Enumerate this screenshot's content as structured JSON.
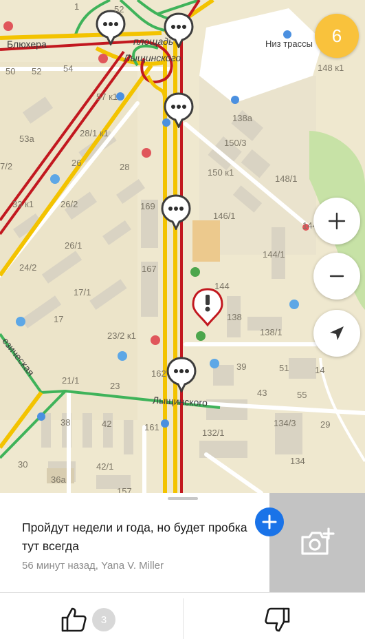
{
  "map": {
    "street_labels": [
      {
        "name": "street-bluhera",
        "text": "Блюхера"
      },
      {
        "name": "street-ploshchad",
        "text": "площадь"
      },
      {
        "name": "street-lyshchinskogo-top",
        "text": "Лыщинского"
      },
      {
        "name": "street-lyshchinskogo-bottom",
        "text": "Лыщинского"
      },
      {
        "name": "street-tekhnicheskaya",
        "text": "езическая"
      }
    ],
    "poi": {
      "niz_trassy": "Низ трассы"
    },
    "house_numbers": [
      "1",
      "52",
      "50",
      "52",
      "54",
      "57 к1",
      "53а",
      "28/1 к1",
      "7/2",
      "26",
      "28",
      "33 к1",
      "26/2",
      "26/1",
      "24/2",
      "17/1",
      "17",
      "23/2 к1",
      "21/1",
      "23",
      "38",
      "42",
      "30",
      "42/1",
      "36а",
      "157",
      "161",
      "162",
      "169",
      "167",
      "144",
      "138",
      "138/1",
      "146/1",
      "144/1",
      "150 к1",
      "150/3",
      "148/1",
      "138а",
      "148 к1",
      "39",
      "51",
      "14",
      "43",
      "55",
      "134/3",
      "132/1",
      "134",
      "29",
      "144"
    ]
  },
  "traffic_score": "6",
  "controls": {
    "zoom_in": "+",
    "zoom_out": "−"
  },
  "comment": {
    "text": "Пройдут недели и года, но будет пробка тут всегда",
    "meta": "56 минут назад, Yana V. Miller"
  },
  "reactions": {
    "likes": "3"
  },
  "icons": {
    "zoom_in": "plus-icon",
    "zoom_out": "minus-icon",
    "locate": "navigation-arrow-icon",
    "add": "plus-icon",
    "photo": "camera-add-icon",
    "like": "thumbs-up-icon",
    "dislike": "thumbs-down-icon",
    "chat": "chat-bubble-icon",
    "incident": "exclamation-icon"
  },
  "colors": {
    "traffic_red": "#c2181f",
    "traffic_yellow": "#f3c300",
    "traffic_green": "#3fb35a",
    "score_badge": "#f9c23c",
    "accent": "#1a73e8"
  }
}
